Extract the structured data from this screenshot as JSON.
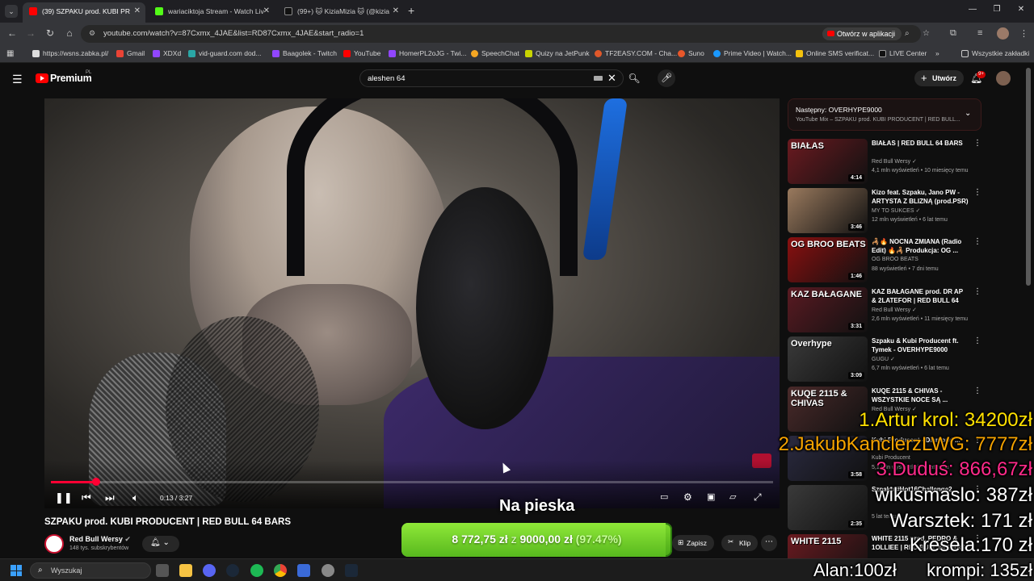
{
  "browser": {
    "tabs": [
      {
        "label": "(39) SZPAKU prod. KUBI PR",
        "active": true
      },
      {
        "label": "wariaciktoja Stream - Watch Liv",
        "active": false
      },
      {
        "label": "(99+) 🐱 KiziaMizia 🐱 (@kizia",
        "active": false
      }
    ],
    "url": "youtube.com/watch?v=87Cxmx_4JAE&list=RD87Cxmx_4JAE&start_radio=1",
    "open_in_app": "Otwórz w aplikacji",
    "bookmarks": [
      "https://wsns.zabka.pl/",
      "Gmail",
      "XDXd",
      "vid-guard.com dod...",
      "Baagolek - Twitch",
      "YouTube",
      "HomerPL2oJG - Twi...",
      "SpeechChat",
      "Quizy na JetPunk",
      "TF2EASY.COM - Cha...",
      "Suno",
      "Prime Video | Watch...",
      "Online SMS verificat...",
      "LIVE Center"
    ],
    "all_bookmarks": "Wszystkie zakładki"
  },
  "youtube": {
    "logo_text": "Premium",
    "region": "PL",
    "search_query": "aleshen 64",
    "create_label": "Utwórz",
    "notif_count": "9+"
  },
  "player": {
    "time": "0:13 / 3:27",
    "progress_fraction": 0.063
  },
  "video": {
    "title": "SZPAKU prod. KUBI PRODUCENT | RED BULL 64 BARS",
    "channel": "Red Bull Wersy",
    "subs": "148 tys. subskrybentów",
    "save_label": "Zapisz",
    "clip_label": "Klip"
  },
  "overlay": {
    "caption": "Na pieska",
    "donation": {
      "current": "8 772,75 zł",
      "separator": "z",
      "goal": "9000,00 zł",
      "percent": "(97.47%)",
      "fraction": 0.9747
    },
    "leaderboard": [
      {
        "text": "1.Artur krol: 34200zł",
        "color": "#ffe000"
      },
      {
        "text": "2.JakubKanclerzLWG: 7777zł",
        "color": "#f5a300"
      },
      {
        "text": "3.Duduś: 866,67zł",
        "color": "#ff2a8a"
      },
      {
        "text": "wikusmaslo: 387zł",
        "color": "#ffffff"
      },
      {
        "text": "Warsztek: 171 zł",
        "color": "#ffffff"
      },
      {
        "text": "Kresela:170 zł",
        "color": "#ffffff"
      },
      {
        "text": "Alan:100zł",
        "color": "#ffffff"
      },
      {
        "text": "krompi: 135zł",
        "color": "#ffffff"
      }
    ]
  },
  "sidebar": {
    "next_label": "Następny: OVERHYPE9000",
    "next_sub": "YouTube Mix – SZPAKU prod. KUBI PRODUCENT | RED BULL...",
    "items": [
      {
        "title": "BIAŁAS | RED BULL 64 BARS",
        "channel": "Red Bull Wersy ✓",
        "meta": "4,1 mln wyświetleń • 10 miesięcy temu",
        "duration": "4:14",
        "thumb_text": "BIAŁAS",
        "color": "#6b1a20"
      },
      {
        "title": "Kizo feat. Szpaku, Jano PW - ARTYSTA Z BLIZNĄ (prod.PSR)",
        "channel": "MY TO SUKCES ✓",
        "meta": "12 mln wyświetleń • 6 lat temu",
        "duration": "3:46",
        "thumb_text": "",
        "color": "#9a7a5e"
      },
      {
        "title": "🦂🔥 NOCNA ZMIANA (Radio Edit) 🔥🦂 Produkcja: OG ...",
        "channel": "OG BROO BEATS",
        "meta": "88 wyświetleń • 7 dni temu",
        "duration": "1:46",
        "thumb_text": "OG BROO BEATS",
        "color": "#8a1010"
      },
      {
        "title": "KAZ BAŁAGANE prod. DR AP & 2LATEFOR | RED BULL 64 BARS",
        "channel": "Red Bull Wersy ✓",
        "meta": "2,6 mln wyświetleń • 11 miesięcy temu",
        "duration": "3:31",
        "thumb_text": "KAZ BAŁAGANE",
        "color": "#5a1a22"
      },
      {
        "title": "Szpaku & Kubi Producent ft. Tymek - OVERHYPE9000",
        "channel": "GUGU ✓",
        "meta": "6,7 mln wyświetleń • 6 lat temu",
        "duration": "3:09",
        "thumb_text": "Overhype",
        "color": "#3a3a3a"
      },
      {
        "title": "KUQE 2115 & CHIVAS - WSZYSTKIE NOCE SĄ ...",
        "channel": "Red Bull Wersy ✓",
        "meta": "",
        "duration": "",
        "thumb_text": "KUQE 2115 & CHIVAS",
        "color": "#4a2a2a"
      },
      {
        "title": "Kubi Producent - Diamond ...",
        "channel": "Kubi Producent",
        "meta": "5,1 mln wyświetleń • 5 lat temu",
        "duration": "3:58",
        "thumb_text": "",
        "color": "#2a2a40"
      },
      {
        "title": "Szpaku #Hot16Challenge2",
        "channel": "",
        "meta": "5 lat temu",
        "duration": "2:35",
        "thumb_text": "",
        "color": "#3a3a3a"
      },
      {
        "title": "WHITE 2115 prod. PEDRO & 1OLLIEE | RED BULL 64 BARS",
        "channel": "",
        "meta": "",
        "duration": "",
        "thumb_text": "WHITE 2115",
        "color": "#6a1a20"
      }
    ]
  },
  "taskbar": {
    "search": "Wyszukaj",
    "icons": [
      "file-explorer",
      "explorer-folder",
      "discord",
      "steam",
      "spotify",
      "chrome",
      "app-a",
      "app-b",
      "steam-2"
    ]
  }
}
